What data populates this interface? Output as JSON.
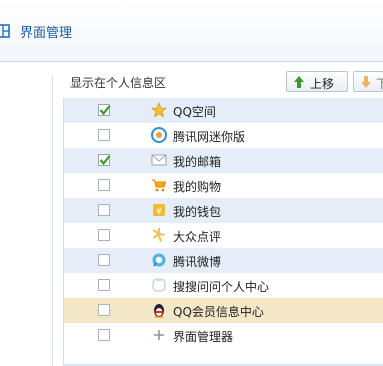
{
  "window": {
    "title": "界面管理"
  },
  "panel": {
    "label": "显示在个人信息区"
  },
  "toolbar": {
    "up_label": "上移",
    "down_label": "下"
  },
  "items": [
    {
      "label": "QQ空间",
      "checked": true,
      "icon": "qzone-star-icon"
    },
    {
      "label": "腾讯网迷你版",
      "checked": false,
      "icon": "tencent-mini-icon"
    },
    {
      "label": "我的邮箱",
      "checked": true,
      "icon": "mail-icon"
    },
    {
      "label": "我的购物",
      "checked": false,
      "icon": "shopping-cart-icon"
    },
    {
      "label": "我的钱包",
      "checked": false,
      "icon": "wallet-icon"
    },
    {
      "label": "大众点评",
      "checked": false,
      "icon": "dianping-icon"
    },
    {
      "label": "腾讯微博",
      "checked": false,
      "icon": "weibo-icon"
    },
    {
      "label": "搜搜问问个人中心",
      "checked": false,
      "icon": "soso-wenwen-icon"
    },
    {
      "label": "QQ会员信息中心",
      "checked": false,
      "icon": "qq-penguin-icon"
    },
    {
      "label": "界面管理器",
      "checked": false,
      "icon": "plus-icon"
    }
  ],
  "colors": {
    "accent": "#1d5a97",
    "check": "#3a9a2a",
    "row_alt": "#e5eef8",
    "row_highlight": "#f3e7c8"
  }
}
